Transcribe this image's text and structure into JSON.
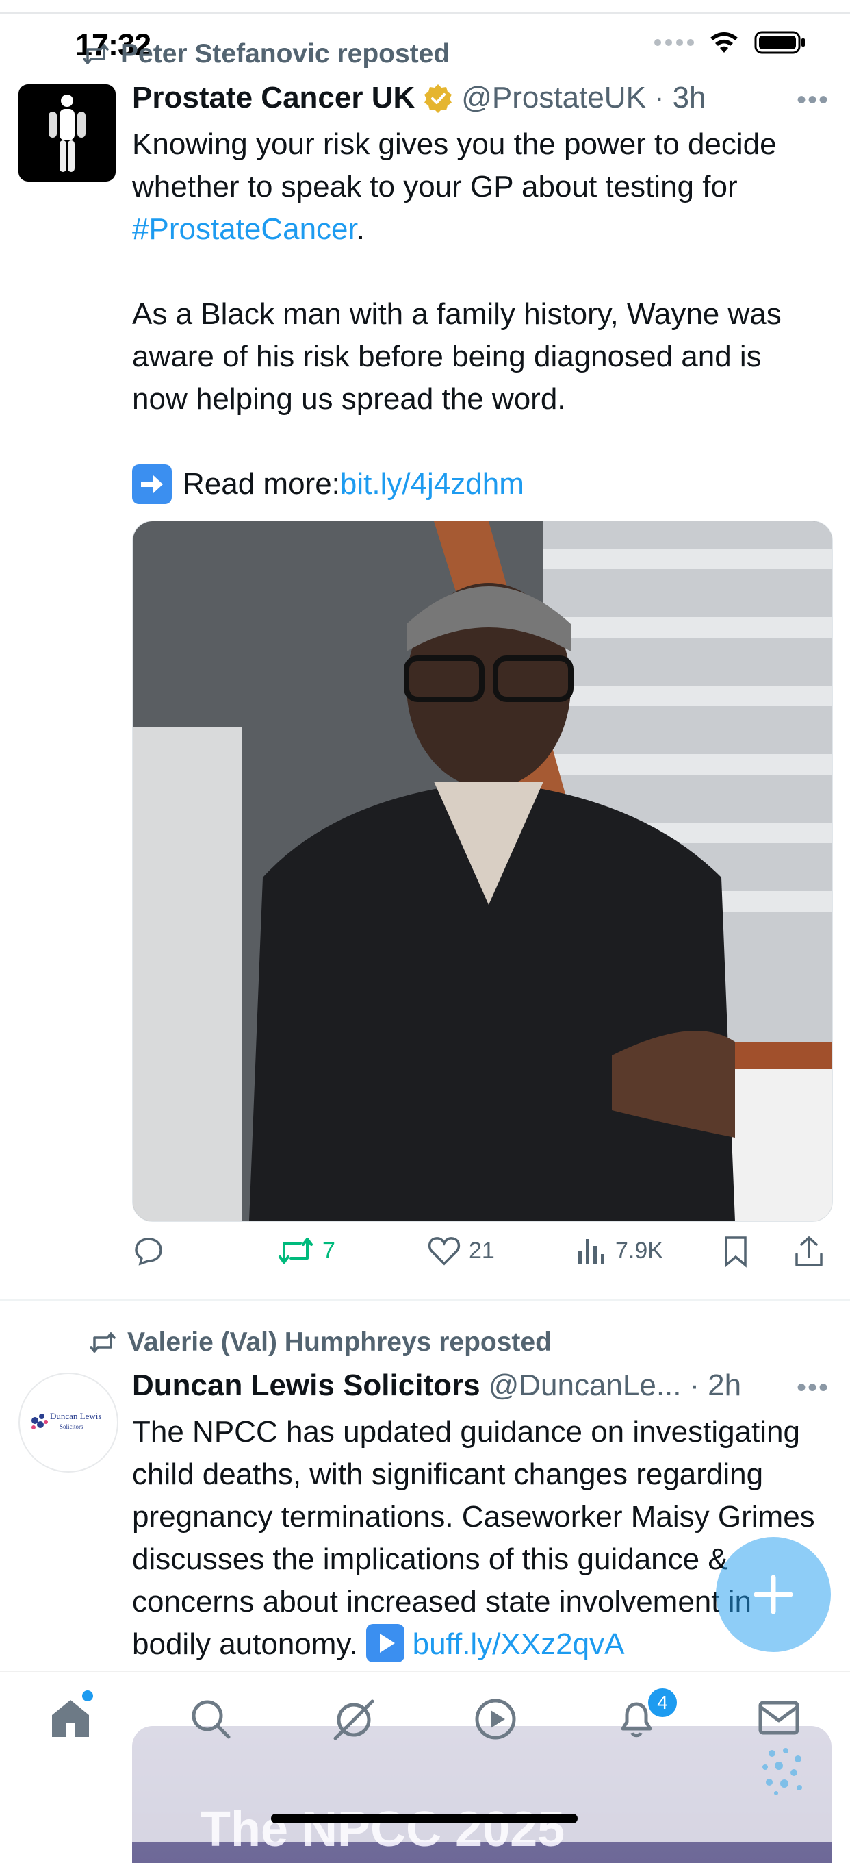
{
  "status_bar": {
    "time": "17:32"
  },
  "tweet1": {
    "repost_label": "Peter Stefanovic reposted",
    "author_name": "Prostate Cancer UK",
    "handle": "@ProstateUK",
    "time": "3h",
    "text_line1_pre": "Knowing your risk gives you the power to decide whether to speak to your GP about testing for ",
    "hashtag": "#ProstateCancer",
    "text_line1_post": ".",
    "text_para2": "As a Black man with a family history, Wayne was aware of his risk before being diagnosed and is now helping us spread the word.",
    "read_more_label": "Read more: ",
    "read_more_link": "bit.ly/4j4zdhm",
    "retweets": "7",
    "likes": "21",
    "views": "7.9K"
  },
  "tweet2": {
    "repost_label": "Valerie (Val) Humphreys reposted",
    "author_name": "Duncan Lewis Solicitors",
    "handle": "@DuncanLe...",
    "time": "2h",
    "text": "The NPCC has updated guidance on investigating child deaths, with significant changes regarding pregnancy terminations. Caseworker Maisy Grimes discusses the implications of this guidance & concerns about increased state involvement in bodily autonomy. ",
    "link": "buff.ly/XXz2qvA",
    "card_title": "The NPCC 2025",
    "avatar_logo_line1": "Duncan Lewis",
    "avatar_logo_line2": "Solicitors"
  },
  "tabbar": {
    "notifications_badge": "4"
  },
  "colors": {
    "accent": "#1d9bf0",
    "retweet_green": "#00ba7c",
    "secondary_text": "#536471"
  },
  "icons": [
    "wifi-icon",
    "battery-icon",
    "repost-icon",
    "verified-badge-icon",
    "more-icon",
    "reply-icon",
    "retweet-icon",
    "like-icon",
    "views-icon",
    "bookmark-icon",
    "share-icon",
    "compose-icon",
    "home-icon",
    "search-icon",
    "grok-icon",
    "video-icon",
    "notifications-icon",
    "messages-icon"
  ]
}
